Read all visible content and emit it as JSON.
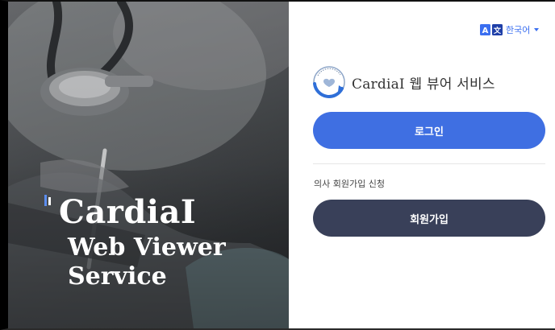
{
  "hero": {
    "title": "CardiaI",
    "subtitle": "Web Viewer Service"
  },
  "language": {
    "icon": "translate-icon",
    "label": "한국어"
  },
  "brand": {
    "logo": "cardiai-logo",
    "name": "CardiaI 웹 뷰어 서비스"
  },
  "login": {
    "label": "로그인"
  },
  "signup": {
    "hint": "의사 회원가입 신청",
    "label": "회원가입"
  },
  "colors": {
    "primary": "#3f6fe2",
    "secondary": "#394059",
    "accent_text": "#3b6ff0"
  }
}
